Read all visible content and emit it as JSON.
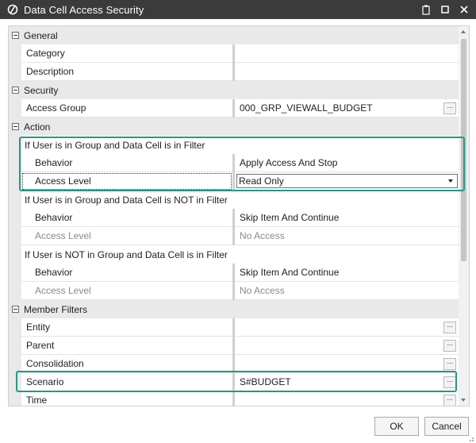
{
  "window": {
    "title": "Data Cell Access Security",
    "icons": {
      "logo": "onestream-logo-icon",
      "clipboard": "clipboard-icon",
      "maximize": "maximize-icon",
      "close": "close-icon"
    }
  },
  "categories": {
    "general": "General",
    "security": "Security",
    "action": "Action",
    "member_filters": "Member Filters"
  },
  "general": {
    "category_label": "Category",
    "category_value": "",
    "description_label": "Description",
    "description_value": ""
  },
  "security": {
    "access_group_label": "Access Group",
    "access_group_value": "000_GRP_VIEWALL_BUDGET",
    "ellipsis": "···"
  },
  "action": {
    "group1_header": "If User is in Group and Data Cell is in Filter",
    "group1_behavior_label": "Behavior",
    "group1_behavior_value": "Apply Access And Stop",
    "group1_access_label": "Access Level",
    "group1_access_value": "Read Only",
    "group2_header": "If User is in Group and Data Cell is NOT in Filter",
    "group2_behavior_label": "Behavior",
    "group2_behavior_value": "Skip Item And Continue",
    "group2_access_label": "Access Level",
    "group2_access_value": "No Access",
    "group3_header": "If User is NOT in Group and Data Cell is in Filter",
    "group3_behavior_label": "Behavior",
    "group3_behavior_value": "Skip Item And Continue",
    "group3_access_label": "Access Level",
    "group3_access_value": "No Access"
  },
  "member_filters": {
    "entity_label": "Entity",
    "entity_value": "",
    "parent_label": "Parent",
    "parent_value": "",
    "consolidation_label": "Consolidation",
    "consolidation_value": "",
    "scenario_label": "Scenario",
    "scenario_value": "S#BUDGET",
    "time_label": "Time",
    "time_value": "",
    "ellipsis": "···"
  },
  "buttons": {
    "ok": "OK",
    "cancel": "Cancel"
  },
  "colors": {
    "titlebar": "#3b3b3b",
    "highlight": "#1f9a86",
    "category_bg": "#e9e9e9"
  }
}
